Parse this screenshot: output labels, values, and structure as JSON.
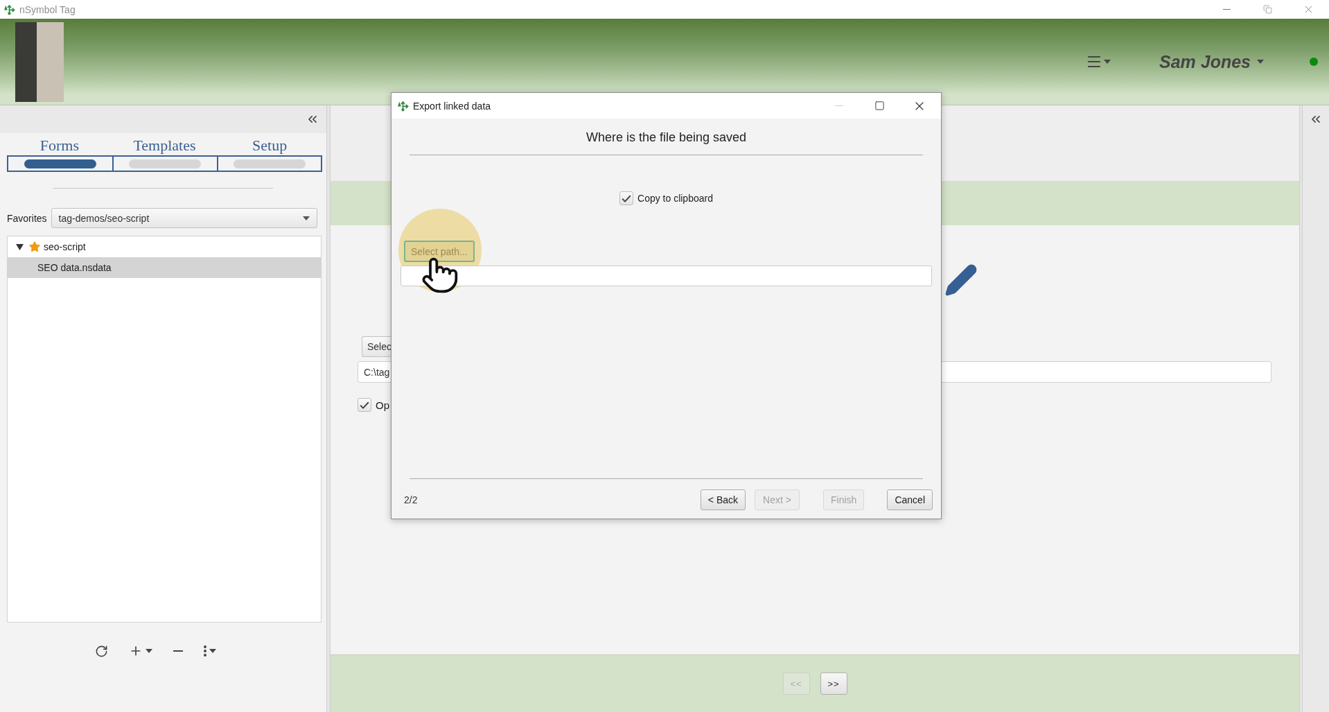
{
  "window": {
    "title": "nSymbol Tag"
  },
  "header": {
    "user": "Sam Jones",
    "online": true
  },
  "sidebar": {
    "tabs": [
      {
        "label": "Forms",
        "selected": true
      },
      {
        "label": "Templates",
        "selected": false
      },
      {
        "label": "Setup",
        "selected": false
      }
    ],
    "favorites": {
      "label": "Favorites",
      "value": "tag-demos/seo-script"
    },
    "tree": [
      {
        "label": "seo-script",
        "starred": true,
        "expanded": true,
        "selected": false,
        "children": [
          {
            "label": "SEO data.nsdata",
            "starred": false,
            "selected": true
          }
        ]
      }
    ]
  },
  "main": {
    "select_button": "Selec",
    "path_field": {
      "value": "C:\\tag"
    },
    "option": {
      "label": "Op",
      "checked": true
    },
    "pager": [
      {
        "label": "<<",
        "disabled": true
      },
      {
        "label": ">>",
        "disabled": false
      }
    ]
  },
  "dialog": {
    "title": "Export linked data",
    "heading": "Where is the file being saved",
    "copy_to_clipboard": {
      "label": "Copy to clipboard",
      "checked": true
    },
    "select_path_button": "Select path...",
    "step": "2/2",
    "buttons": [
      {
        "label": "< Back",
        "disabled": false
      },
      {
        "label": "Next >",
        "disabled": true
      },
      {
        "label": "Finish",
        "disabled": true
      },
      {
        "label": "Cancel",
        "disabled": false
      }
    ]
  }
}
